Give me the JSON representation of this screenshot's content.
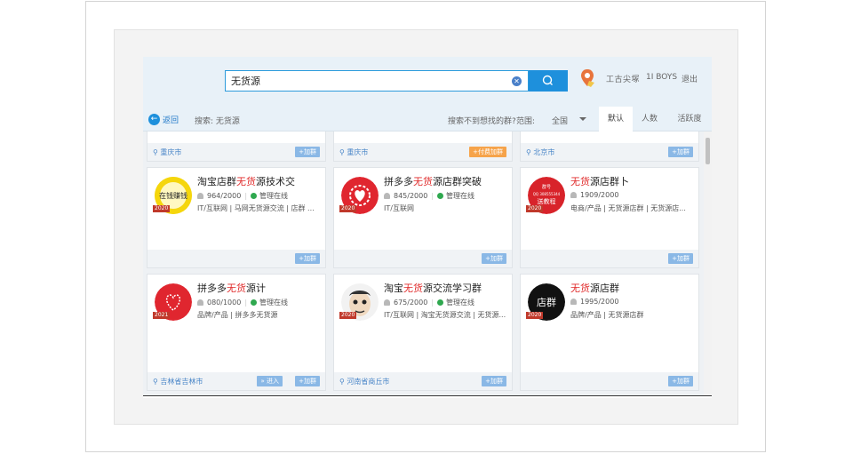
{
  "header": {
    "search_value": "无货源",
    "user_name": "工古尖塚",
    "user_id": "1I BOYS",
    "logout_label": "退出"
  },
  "toolbar": {
    "back_label": "返回",
    "search_label": "搜索: 无货源",
    "not_found_label": "搜索不到想找的群?",
    "range_label": "范围:",
    "range_value": "全国",
    "tabs": [
      "默认",
      "人数",
      "活跃度"
    ]
  },
  "groups": [
    {
      "location": "重庆市",
      "join_label": "+加群"
    },
    {
      "location": "重庆市",
      "join_label": "+付费加群"
    },
    {
      "location": "北京市",
      "join_label": "+加群"
    },
    {
      "title_pre": "淘宝店群",
      "title_hl": "无货",
      "title_post": "源技术交",
      "members": "964/2000",
      "status": "管理在线",
      "tags": "IT/互联网 | 马网无货源交流 | 店群 ...",
      "location": "",
      "join_label": "+加群",
      "year": "2020"
    },
    {
      "title_pre": "拼多多",
      "title_hl": "无货",
      "title_post": "源店群突破",
      "members": "845/2000",
      "status": "管理在线",
      "tags": "IT/互联网",
      "location": "",
      "join_label": "+加群",
      "year": "2020"
    },
    {
      "title_pre": "",
      "title_hl": "无货",
      "title_post": "源店群卜",
      "members": "1909/2000",
      "status": "",
      "tags": "电商/产品 | 无货源店群 | 无货源店...",
      "location": "",
      "join_label": "+加群",
      "year": "2020"
    },
    {
      "title_pre": "拼多多",
      "title_hl": "无货",
      "title_post": "源计",
      "members": "080/1000",
      "status": "管理在线",
      "tags": "品牌/产品 | 拼多多无货源",
      "location": "吉林省吉林市",
      "follow_label": "» 进入",
      "join_label": "+加群",
      "year": "2021"
    },
    {
      "title_pre": "淘宝",
      "title_hl": "无货",
      "title_post": "源交流学习群",
      "members": "675/2000",
      "status": "管理在线",
      "tags": "IT/互联网 | 淘宝无货源交流 | 无货源...",
      "location": "河南省商丘市",
      "join_label": "+加群",
      "year": "2020"
    },
    {
      "title_pre": "",
      "title_hl": "无货",
      "title_post": "源店群",
      "members": "1995/2000",
      "status": "",
      "tags": "品牌/产品 | 无货源店群",
      "location": "",
      "join_label": "+加群",
      "year": "2020"
    }
  ],
  "avatar_texts": {
    "a1": "在钱赚钱",
    "a3_line1": "群号",
    "a3_line2": "QQ 308555344",
    "a3_line3": "送教程",
    "a6": "店群"
  },
  "colors": {
    "accent": "#1e90dc",
    "highlight": "#e02a2a",
    "orange": "#f6a34a"
  }
}
